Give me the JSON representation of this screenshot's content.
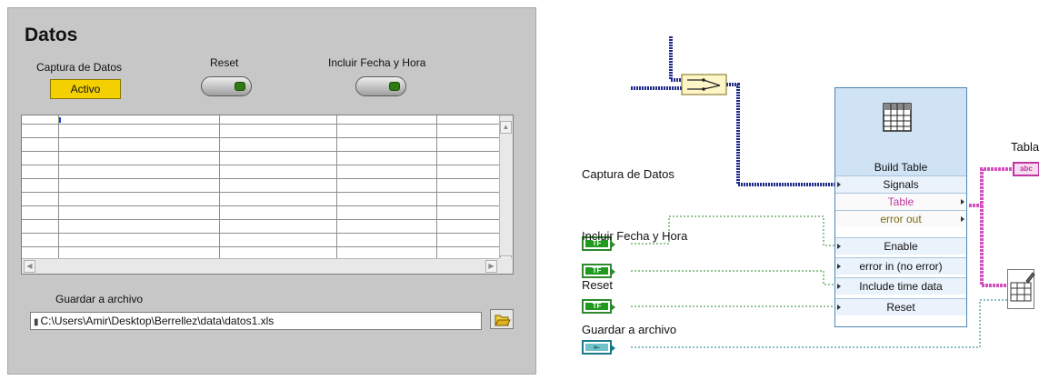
{
  "front_panel": {
    "title": "Datos",
    "captura_label": "Captura de Datos",
    "captura_led_text": "Activo",
    "reset_label": "Reset",
    "fecha_label": "Incluir Fecha y Hora",
    "guardar_label": "Guardar a archivo",
    "file_path": "C:\\Users\\Amir\\Desktop\\Berrellez\\data\\datos1.xls",
    "led_color": "#f4d000",
    "panel_color": "#c7c7c7"
  },
  "block_diagram": {
    "captura_label": "Captura de Datos",
    "fecha_label": "Incluir Fecha y Hora",
    "reset_label": "Reset",
    "guardar_label": "Guardar a archivo",
    "bool_term_text": "TF",
    "path_term_icon": "path-icon",
    "express_vi": {
      "title": "Build Table",
      "rows": [
        "Signals",
        "Table",
        "error out",
        "Enable",
        "error in (no error)",
        "Include time data",
        "Reset"
      ]
    },
    "tabla_label": "Tabla",
    "tabla_term_text": "abc",
    "wire_colors": {
      "dynamic": "#1f2a8a",
      "boolean": "#2d8a2d",
      "string": "#d44fbd",
      "path": "#1a7a8a"
    }
  }
}
